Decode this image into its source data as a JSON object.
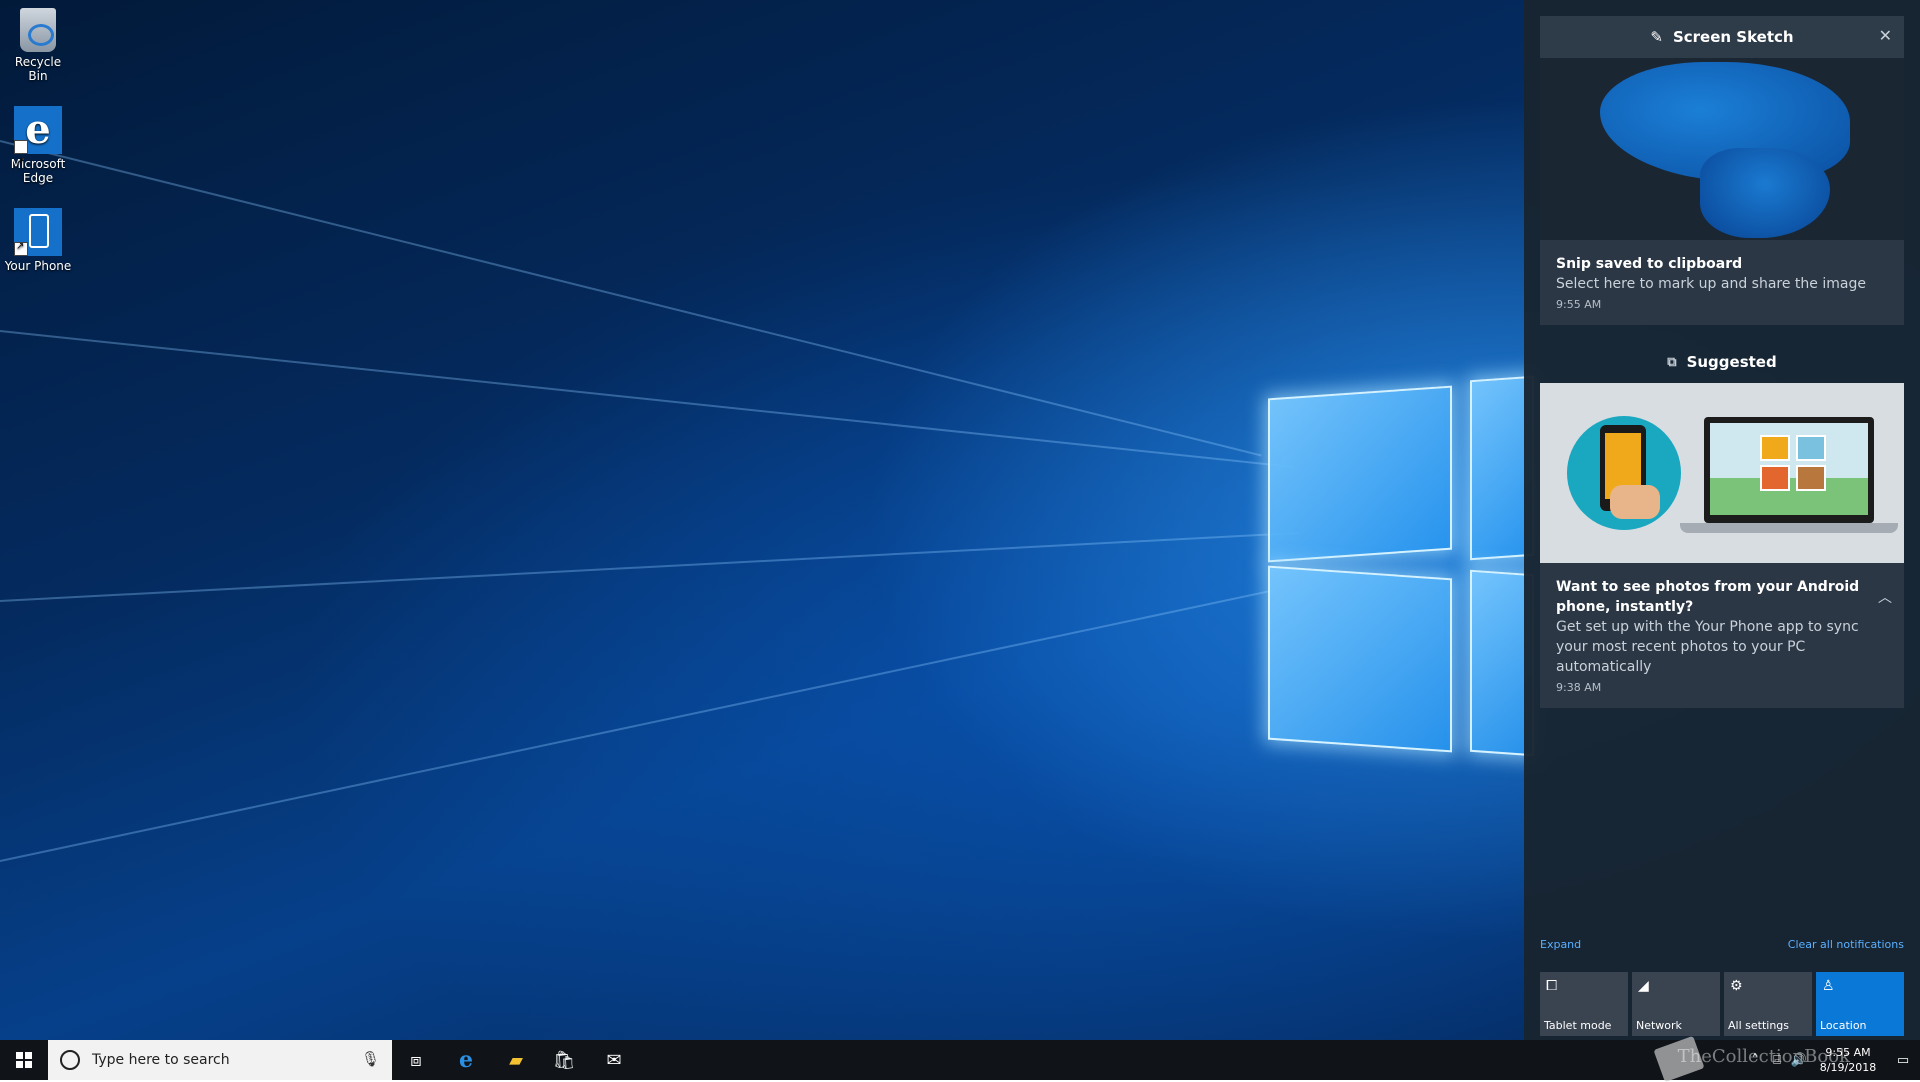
{
  "desktop": {
    "icons": [
      {
        "label": "Recycle Bin",
        "icon": "recycle-bin-icon"
      },
      {
        "label": "Microsoft Edge",
        "icon": "edge-icon"
      },
      {
        "label": "Your Phone",
        "icon": "your-phone-icon"
      }
    ]
  },
  "action_center": {
    "screen_sketch": {
      "app_name": "Screen Sketch",
      "title": "Snip saved to clipboard",
      "body": "Select here to mark up and share the image",
      "time": "9:55 AM"
    },
    "suggested": {
      "header": "Suggested",
      "title": "Want to see photos from your Android phone, instantly?",
      "body": "Get set up with the Your Phone app to sync your most recent photos to your PC automatically",
      "time": "9:38 AM"
    },
    "expand_label": "Expand",
    "clear_label": "Clear all notifications",
    "quick_actions": [
      {
        "label": "Tablet mode",
        "icon": "tablet-mode-icon",
        "active": false
      },
      {
        "label": "Network",
        "icon": "network-icon",
        "active": false
      },
      {
        "label": "All settings",
        "icon": "gear-icon",
        "active": false
      },
      {
        "label": "Location",
        "icon": "location-icon",
        "active": true
      }
    ]
  },
  "taskbar": {
    "search_placeholder": "Type here to search",
    "clock_time": "9:55 AM",
    "clock_date": "8/19/2018",
    "watermark": "TheCollectionBook"
  },
  "colors": {
    "accent": "#0a78d7",
    "link": "#5ab0ff"
  }
}
